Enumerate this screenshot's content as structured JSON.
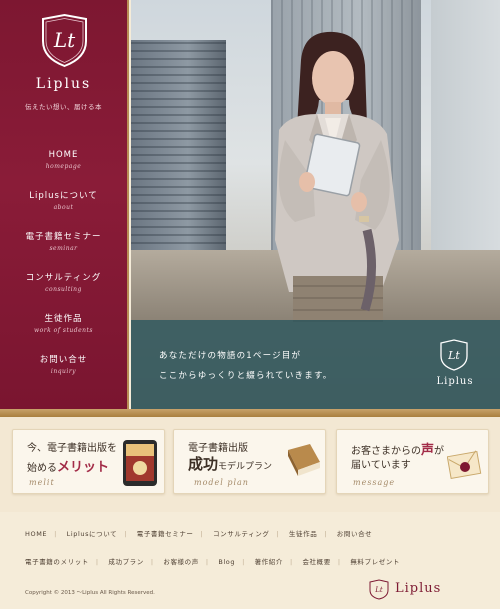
{
  "brand": {
    "name": "Liplus",
    "tagline": "伝えたい想い、届ける本",
    "monogram": "Lt",
    "color_primary": "#7d1731",
    "color_accent": "#a22b47",
    "color_gold": "#b88d55"
  },
  "sidebar": {
    "items": [
      {
        "label": "HOME",
        "sub": "homepage"
      },
      {
        "label": "Liplusについて",
        "sub": "about"
      },
      {
        "label": "電子書籍セミナー",
        "sub": "seminar"
      },
      {
        "label": "コンサルティング",
        "sub": "consulting"
      },
      {
        "label": "生徒作品",
        "sub": "work of students"
      },
      {
        "label": "お問い合せ",
        "sub": "inquiry"
      }
    ]
  },
  "hero": {
    "line1": "あなただけの物語の1ページ目が",
    "line2": "ここからゆっくりと綴られていきます。",
    "logo_text": "Liplus"
  },
  "features": [
    {
      "title_a": "今、電子書籍出版を",
      "title_b_prefix": "始める",
      "title_b_accent": "メリット",
      "en": "melit",
      "icon": "ebook-tablet-icon"
    },
    {
      "title_a": "電子書籍出版",
      "title_b_big": "成功",
      "title_b_suffix": "モデルプラン",
      "en": "model plan",
      "icon": "book-icon"
    },
    {
      "title_a_prefix": "お客さまからの",
      "title_a_accent": "声",
      "title_a_suffix": "が",
      "title_b": "届いています",
      "en": "message",
      "icon": "envelope-icon"
    }
  ],
  "footer": {
    "row1": [
      "HOME",
      "Liplusについて",
      "電子書籍セミナー",
      "コンサルティング",
      "生徒作品",
      "お問い合せ"
    ],
    "row2": [
      "電子書籍のメリット",
      "成功プラン",
      "お客様の声",
      "Blog",
      "著作紹介",
      "会社概要",
      "無料プレゼント"
    ],
    "copyright": "Copyright © 2013 ～Liplus All Rights Reserved.",
    "logo_text": "Liplus"
  }
}
